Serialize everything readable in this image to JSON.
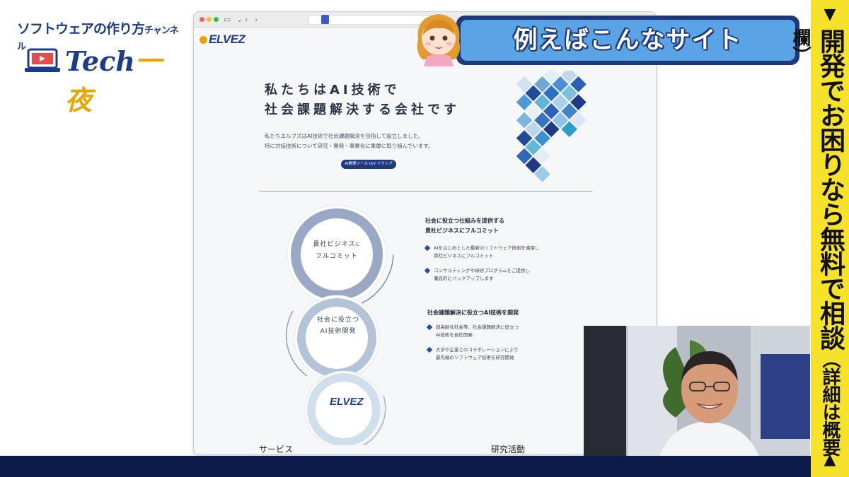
{
  "channel": {
    "name_main": "ソフトウェアの作り方",
    "name_small": "チャンネル",
    "tech": "Tech",
    "yoru": "一夜"
  },
  "caption": {
    "text": "例えばこんなサイト"
  },
  "side_banner": {
    "arrow_top": "▼",
    "text_main": "開発でお困りなら無料で相談",
    "text_paren": "（詳細は概要欄）",
    "arrow_bottom": "▲"
  },
  "site": {
    "logo": "ELVEZ",
    "hero": {
      "title_line1": "私たちはAI技術で",
      "title_line2": "社会課題解決する会社です",
      "desc_line1": "私たちエルブズはAI技術で社会課題解決を目指して設立しました。",
      "desc_line2": "特に対話技術について研究・開発・事業化に果敢に取り組んでいます。",
      "button": "AI開発ツール IXV イクシブ"
    },
    "circles": {
      "top_line1": "貴社ビジネス",
      "top_line1_small": "に",
      "top_line2": "フルコミット",
      "middle_line1": "社会に役立つ",
      "middle_line2": "AI技術開発",
      "bottom_logo": "ELVEZ"
    },
    "feature1": {
      "head_line1": "社会に役立つ仕組みを提供する",
      "head_line2": "貴社ビジネスにフルコミット",
      "item1_line1": "AIをはじめとした最新のソフトウェア技術を適用し",
      "item1_line2": "貴社ビジネスにフルコミット",
      "item2_line1": "コンサルティングや研修プログラムをご提供し",
      "item2_line2": "徹底的にバックアップします"
    },
    "feature2": {
      "head": "社会課題解決に役立つAI技術を開発",
      "item1_line1": "超高齢化社会等、社会課題解決に役立つ",
      "item1_line2": "AI技術を自社開発",
      "item2_line1": "大学や企業とのコラボレーションにより",
      "item2_line2": "最先端のソフトウェア技術を研究開発"
    },
    "section_services": "サービス",
    "section_research": "研究活動"
  },
  "colors": {
    "navy": "#1c3a78",
    "banner_blue": "#5aa4e6",
    "side_yellow": "#f6e12b",
    "brand_blue": "#1d3e96"
  }
}
